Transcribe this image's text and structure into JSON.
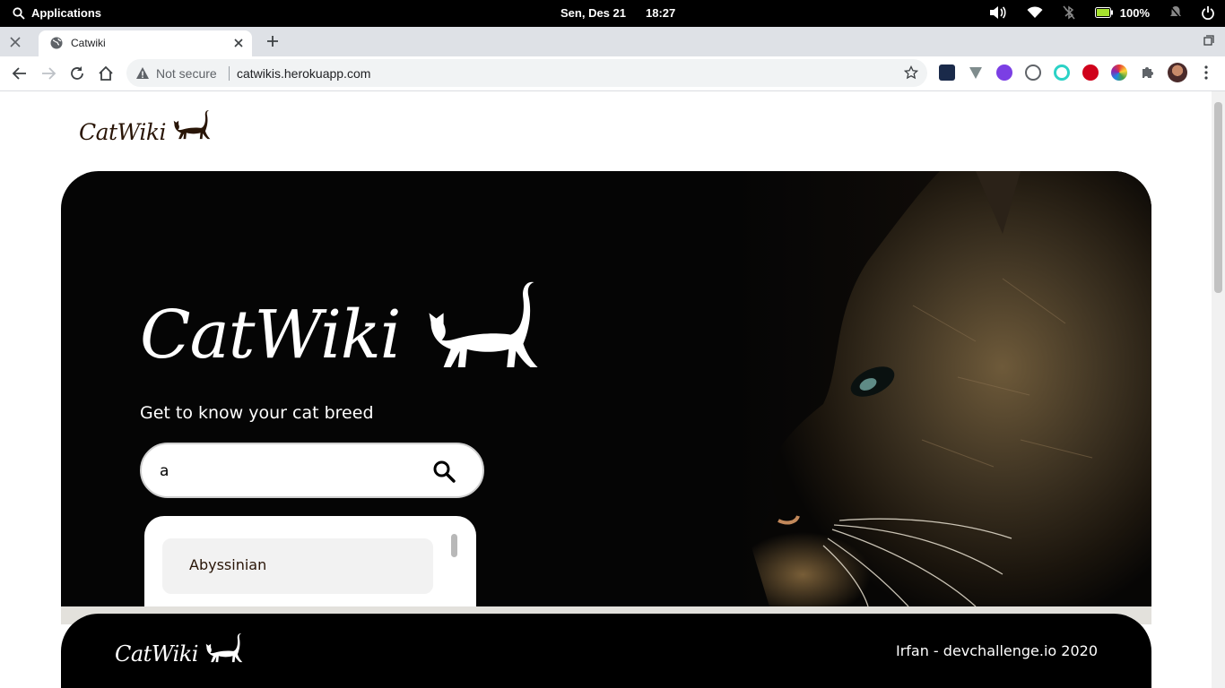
{
  "os_bar": {
    "apps_label": "Applications",
    "date": "Sen, Des 21",
    "time": "18:27",
    "battery": "100%"
  },
  "browser": {
    "tab_title": "Catwiki",
    "security_label": "Not secure",
    "url": "catwikis.herokuapp.com"
  },
  "page": {
    "header_logo": "CatWiki",
    "hero": {
      "title": "CatWiki",
      "tagline": "Get to know your cat breed"
    },
    "search": {
      "value": "a"
    },
    "suggestions": [
      "Abyssinian"
    ],
    "footer": {
      "logo": "CatWiki",
      "credit": "Irfan - devchallenge.io 2020"
    }
  },
  "colors": {
    "brand_dark": "#291507",
    "hero_bg": "#050505"
  }
}
